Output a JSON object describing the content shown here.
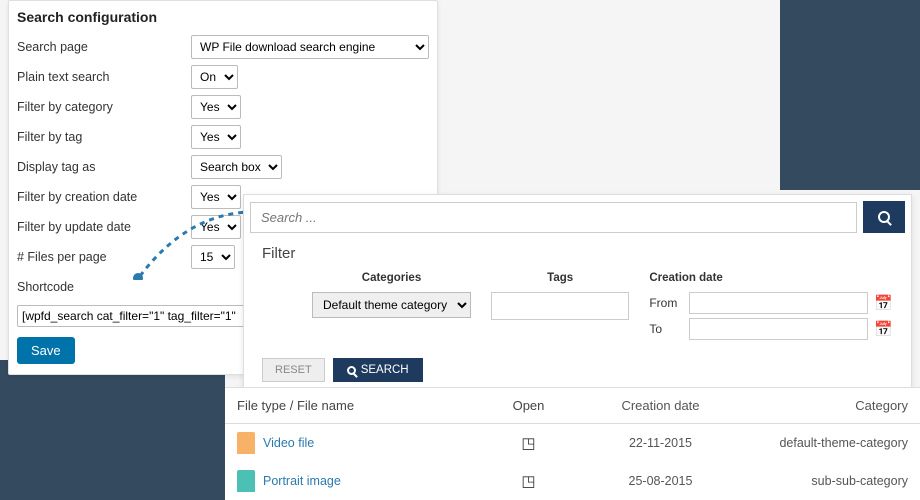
{
  "config": {
    "title": "Search configuration",
    "rows": {
      "search_page": {
        "label": "Search page",
        "value": "WP File download search engine"
      },
      "plain_text": {
        "label": "Plain text search",
        "value": "On"
      },
      "filter_category": {
        "label": "Filter by category",
        "value": "Yes"
      },
      "filter_tag": {
        "label": "Filter by tag",
        "value": "Yes"
      },
      "display_tag": {
        "label": "Display tag as",
        "value": "Search box"
      },
      "filter_creation": {
        "label": "Filter by creation date",
        "value": "Yes"
      },
      "filter_update": {
        "label": "Filter by update date",
        "value": "Yes"
      },
      "files_per_page": {
        "label": "# Files per page",
        "value": "15"
      },
      "shortcode": {
        "label": "Shortcode",
        "value": "[wpfd_search cat_filter=\"1\" tag_filter=\"1\""
      }
    },
    "save": "Save"
  },
  "search": {
    "placeholder": "Search ...",
    "filter_heading": "Filter",
    "categories_label": "Categories",
    "category_value": "Default theme category",
    "tags_label": "Tags",
    "creation_date_label": "Creation date",
    "from_label": "From",
    "to_label": "To",
    "reset": "RESET",
    "search_btn": "SEARCH"
  },
  "results": {
    "headers": {
      "name": "File type / File name",
      "open": "Open",
      "date": "Creation date",
      "category": "Category"
    },
    "rows": [
      {
        "name": "Video file",
        "date": "22-11-2015",
        "category": "default-theme-category",
        "icon": "orange"
      },
      {
        "name": "Portrait image",
        "date": "25-08-2015",
        "category": "sub-sub-category",
        "icon": "teal"
      }
    ]
  }
}
